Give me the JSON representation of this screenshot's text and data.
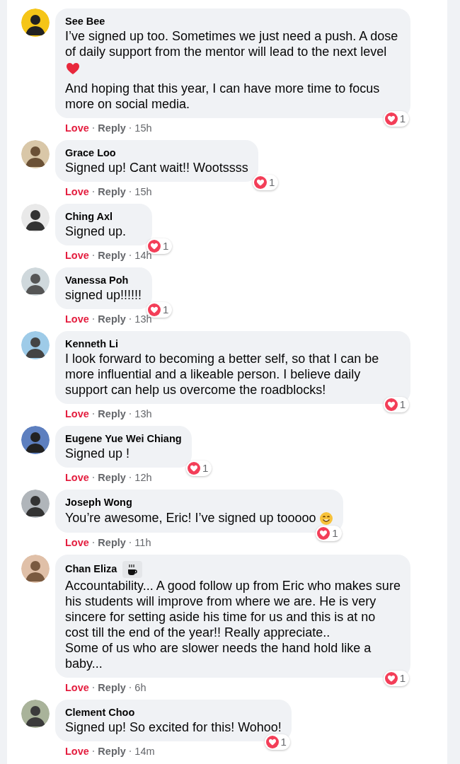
{
  "comments": [
    {
      "author": "See Bee",
      "badge": false,
      "paragraphs": [
        {
          "kind": "text",
          "text": "I’ve signed up too. Sometimes we just need a push. A dose of daily support from the mentor will lead to the next level"
        },
        {
          "kind": "emoji"
        },
        {
          "kind": "text",
          "text": "And hoping that this year, I can have more time to focus more on social media."
        }
      ],
      "trailing_emoji": false,
      "love": "Love",
      "loved": true,
      "reply": "Reply",
      "time": "15h",
      "reaction_count": "1"
    },
    {
      "author": "Grace Loo",
      "badge": false,
      "paragraphs": [
        {
          "kind": "text",
          "text": "Signed up! Cant wait!! Wootssss"
        }
      ],
      "trailing_emoji": false,
      "love": "Love",
      "loved": true,
      "reply": "Reply",
      "time": "15h",
      "reaction_count": "1"
    },
    {
      "author": "Ching Axl",
      "badge": false,
      "paragraphs": [
        {
          "kind": "text",
          "text": "Signed up."
        }
      ],
      "trailing_emoji": false,
      "love": "Love",
      "loved": true,
      "reply": "Reply",
      "time": "14h",
      "reaction_count": "1"
    },
    {
      "author": "Vanessa Poh",
      "badge": false,
      "paragraphs": [
        {
          "kind": "text",
          "text": "signed up!!!!!!"
        }
      ],
      "trailing_emoji": false,
      "love": "Love",
      "loved": true,
      "reply": "Reply",
      "time": "13h",
      "reaction_count": "1"
    },
    {
      "author": "Kenneth Li",
      "badge": false,
      "paragraphs": [
        {
          "kind": "text",
          "text": "I look forward to becoming a better self, so that I can be more influential and a likeable person. I believe daily support can help us overcome the roadblocks!"
        }
      ],
      "trailing_emoji": false,
      "love": "Love",
      "loved": true,
      "reply": "Reply",
      "time": "13h",
      "reaction_count": "1"
    },
    {
      "author": "Eugene Yue Wei Chiang",
      "badge": false,
      "paragraphs": [
        {
          "kind": "text",
          "text": "Signed up !"
        }
      ],
      "trailing_emoji": false,
      "love": "Love",
      "loved": true,
      "reply": "Reply",
      "time": "12h",
      "reaction_count": "1"
    },
    {
      "author": "Joseph Wong",
      "paragraphs": [
        {
          "kind": "text",
          "text": "You’re awesome, Eric! I’ve signed up tooooo"
        }
      ],
      "trailing_emoji": true,
      "love": "Love",
      "loved": true,
      "reply": "Reply",
      "time": "11h",
      "reaction_count": "1"
    },
    {
      "author": "Chan Eliza",
      "badge": true,
      "paragraphs": [
        {
          "kind": "text",
          "text": "Accountability... A good follow up from Eric who makes sure his students will improve from where we are. He is very sincere for setting aside his time for us and this is at no cost till the end of the year!! Really appreciate..\nSome of us who are slower needs the hand hold like a baby..."
        }
      ],
      "love": "Love",
      "loved": true,
      "reply": "Reply",
      "time": "6h",
      "reaction_count": "1"
    },
    {
      "author": "Clement Choo",
      "badge": false,
      "paragraphs": [
        {
          "kind": "text",
          "text": "Signed up! So excited for this! Wohoo!"
        }
      ],
      "trailing_emoji": false,
      "love": "Love",
      "loved": true,
      "reply": "Reply",
      "time": "14m",
      "reaction_count": "1"
    }
  ]
}
